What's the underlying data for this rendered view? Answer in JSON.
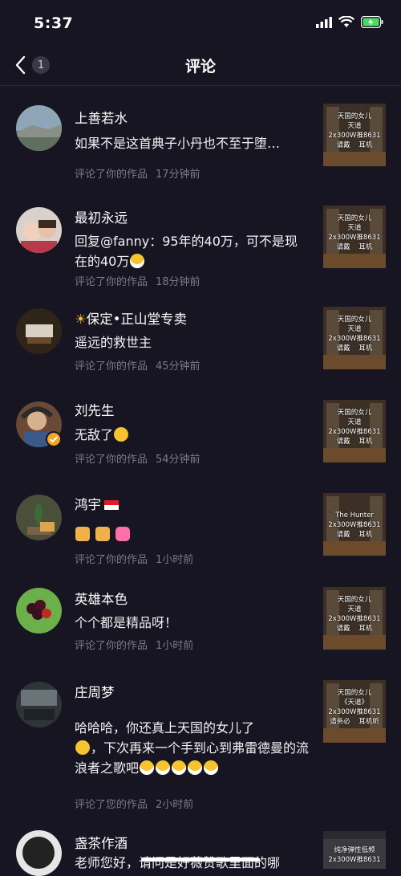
{
  "status": {
    "time": "5:37"
  },
  "nav": {
    "back_count": "1",
    "title": "评论"
  },
  "comments": [
    {
      "user": "上善若水",
      "text": "如果不是这首典子小丹也不至于堕…",
      "action": "评论了你的作品",
      "time": "17分钟前",
      "thumb": "天国的女儿\n天道\n2x300W推8631\n请戴    耳机"
    },
    {
      "user": "最初永远",
      "text": "回复@fanny：95年的40万，可不是现在的40万",
      "action": "评论了你的作品",
      "time": "18分钟前",
      "thumb": "天国的女儿\n天道\n2x300W推8631\n请戴    耳机"
    },
    {
      "user": "保定•正山堂专卖",
      "text": "遥远的救世主",
      "action": "评论了你的作品",
      "time": "45分钟前",
      "thumb": "天国的女儿\n天道\n2x300W推8631\n请戴    耳机"
    },
    {
      "user": "刘先生",
      "text": "无敌了",
      "action": "评论了你的作品",
      "time": "54分钟前",
      "thumb": "天国的女儿\n天道\n2x300W推8631\n请戴    耳机"
    },
    {
      "user": "鸿宇",
      "text": "",
      "action": "评论了你的作品",
      "time": "1小时前",
      "thumb": "The Hunter\n2x300W推8631\n请戴    耳机"
    },
    {
      "user": "英雄本色",
      "text": "个个都是精品呀！",
      "action": "评论了你的作品",
      "time": "1小时前",
      "thumb": "天国的女儿\n天道\n2x300W推8631\n请戴    耳机"
    },
    {
      "user": "庄周梦",
      "text": "哈哈哈，你还真上天国的女儿了",
      "text2": "，下次再来一个手到心到弗雷德曼的流浪者之歌吧",
      "action": "评论了您的作品",
      "time": "2小时前",
      "thumb": "天国的女儿\n《天道》\n2x300W推8631\n请务必    耳机听"
    },
    {
      "user": "盏茶作酒",
      "text": "老师您好，请问是好薇赞歌里面的哪",
      "action": "",
      "time": "",
      "thumb": "纯净弹性低频\n2x300W推8631"
    }
  ],
  "colors": {
    "background": "#171521",
    "meta": "#7b7a85",
    "divider": "#2b2935"
  }
}
